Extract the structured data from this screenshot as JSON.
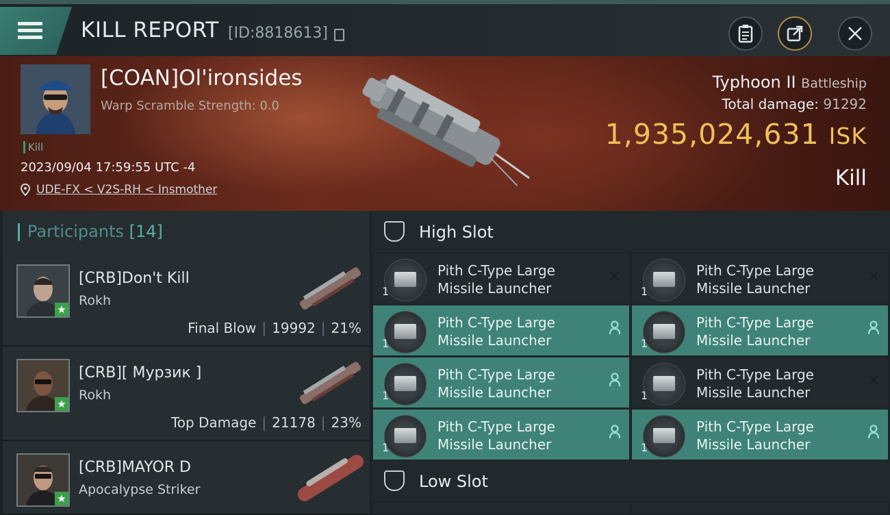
{
  "header": {
    "title": "KILL REPORT",
    "report_id": "[ID:8818613]"
  },
  "victim": {
    "name": "[COAN]Ol'ironsides",
    "warp_scramble": "Warp Scramble Strength: 0.0",
    "kill_tag": "Kill",
    "timestamp": "2023/09/04 17:59:55 UTC -4",
    "location": "UDE-FX < V2S-RH < Insmother",
    "ship_name": "Typhoon II",
    "ship_class": "Battleship",
    "total_damage_label": "Total damage:",
    "total_damage": "91292",
    "isk_value": "1,935,024,631",
    "isk_unit": "ISK",
    "result": "Kill"
  },
  "participants": {
    "label": "Participants",
    "count": "[14]",
    "items": [
      {
        "name": "[CRB]Don't Kill",
        "ship": "Rokh",
        "tag": "Final Blow",
        "damage": "19992",
        "percent": "21%"
      },
      {
        "name": "[CRB][ Мурзик ]",
        "ship": "Rokh",
        "tag": "Top Damage",
        "damage": "21178",
        "percent": "23%"
      },
      {
        "name": "[CRB]MAYOR D",
        "ship": "Apocalypse Striker",
        "tag": "",
        "damage": "",
        "percent": ""
      }
    ]
  },
  "high_slot": {
    "title": "High Slot",
    "modules": [
      {
        "name_line1": "Pith C-Type Large",
        "name_line2": "Missile Launcher",
        "qty": "1",
        "active": false,
        "status_icon": "x-icon"
      },
      {
        "name_line1": "Pith C-Type Large",
        "name_line2": "Missile Launcher",
        "qty": "1",
        "active": false,
        "status_icon": "x-icon"
      },
      {
        "name_line1": "Pith C-Type Large",
        "name_line2": "Missile Launcher",
        "qty": "1",
        "active": true,
        "status_icon": "person-icon"
      },
      {
        "name_line1": "Pith C-Type Large",
        "name_line2": "Missile Launcher",
        "qty": "1",
        "active": true,
        "status_icon": "person-icon"
      },
      {
        "name_line1": "Pith C-Type Large",
        "name_line2": "Missile Launcher",
        "qty": "1",
        "active": true,
        "status_icon": "person-icon"
      },
      {
        "name_line1": "Pith C-Type Large",
        "name_line2": "Missile Launcher",
        "qty": "1",
        "active": false,
        "status_icon": "x-icon"
      },
      {
        "name_line1": "Pith C-Type Large",
        "name_line2": "Missile Launcher",
        "qty": "1",
        "active": true,
        "status_icon": "person-icon"
      },
      {
        "name_line1": "Pith C-Type Large",
        "name_line2": "Missile Launcher",
        "qty": "1",
        "active": true,
        "status_icon": "person-icon"
      }
    ]
  },
  "low_slot": {
    "title": "Low Slot"
  },
  "colors": {
    "accent_teal": "#3f8378",
    "isk_gold": "#f0c05a",
    "final_star": "#3ca04a"
  }
}
